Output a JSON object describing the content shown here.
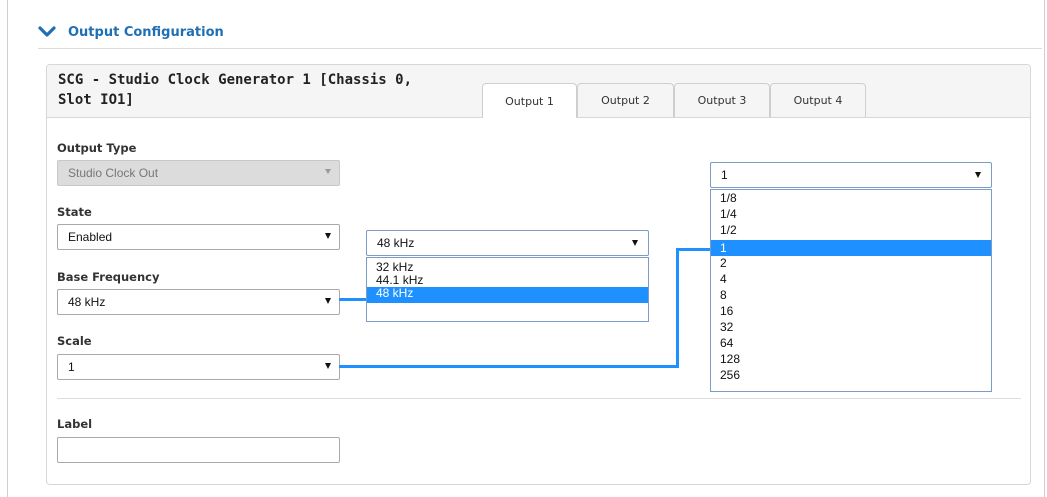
{
  "section": {
    "title": "Output Configuration",
    "icon": "chevron-down-icon",
    "accent": "#1f6fb5"
  },
  "panel": {
    "title": "SCG - Studio Clock Generator 1 [Chassis 0, Slot IO1]",
    "tabs": [
      {
        "label": "Output 1",
        "active": true
      },
      {
        "label": "Output 2",
        "active": false
      },
      {
        "label": "Output 3",
        "active": false
      },
      {
        "label": "Output 4",
        "active": false
      }
    ]
  },
  "form": {
    "output_type": {
      "label": "Output Type",
      "value": "Studio Clock Out",
      "disabled": true
    },
    "state": {
      "label": "State",
      "value": "Enabled"
    },
    "base_frequency": {
      "label": "Base Frequency",
      "value": "48 kHz"
    },
    "scale": {
      "label": "Scale",
      "value": "1"
    },
    "label_field": {
      "label": "Label",
      "value": ""
    }
  },
  "frequency_dropdown": {
    "selected": "48 kHz",
    "options": [
      "32 kHz",
      "44.1 kHz",
      "48 kHz"
    ],
    "highlighted_index": 2
  },
  "scale_dropdown": {
    "selected": "1",
    "options": [
      "1/8",
      "1/4",
      "1/2",
      "1",
      "2",
      "4",
      "8",
      "16",
      "32",
      "64",
      "128",
      "256"
    ],
    "highlighted_index": 3
  },
  "colors": {
    "highlight": "#1e90ff",
    "connector": "#1e90ff"
  }
}
